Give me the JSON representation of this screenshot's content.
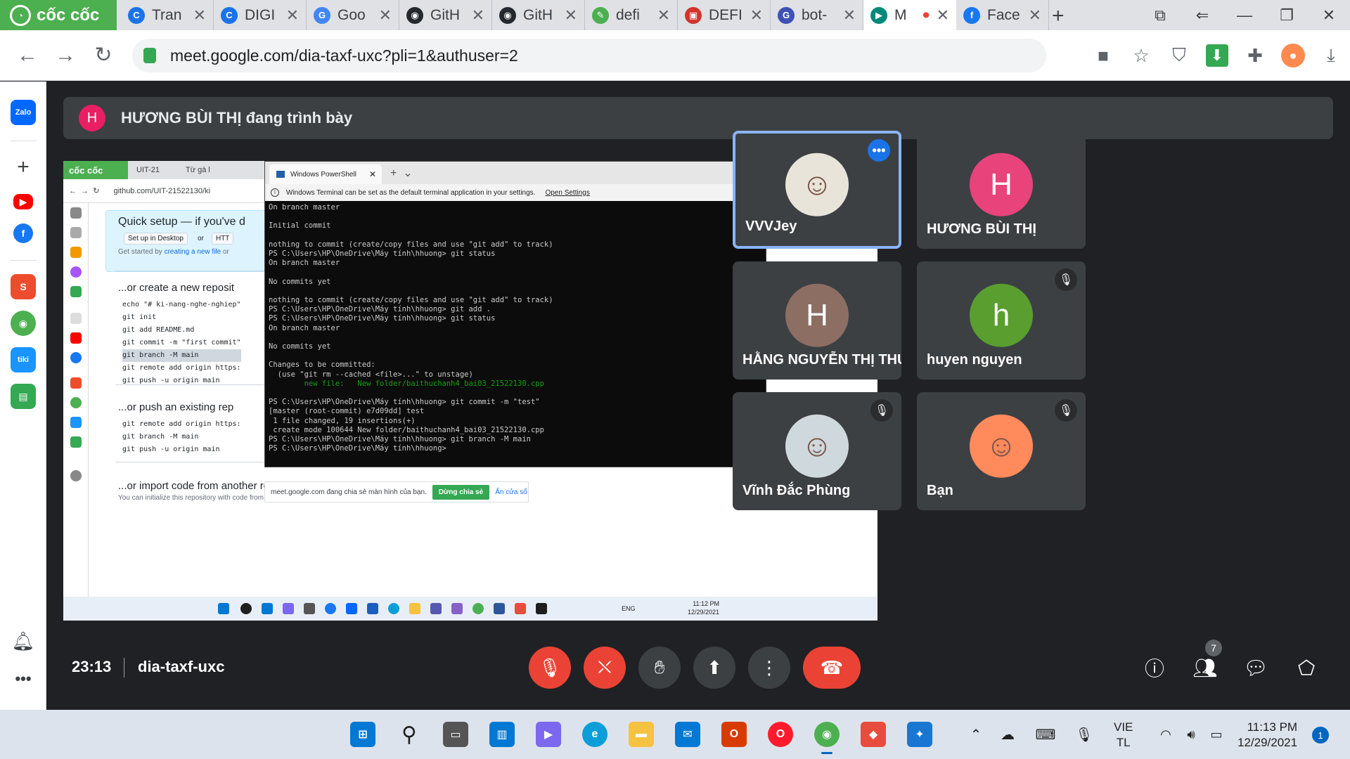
{
  "browser": {
    "brand": "cốc cốc",
    "tabs": [
      {
        "label": "Tran",
        "color": "#1a73e8",
        "glyph": "C"
      },
      {
        "label": "DIGI",
        "color": "#1a73e8",
        "glyph": "C"
      },
      {
        "label": "Goo",
        "color": "#4285f4",
        "glyph": "G"
      },
      {
        "label": "GitH",
        "color": "#24292f",
        "glyph": "◉"
      },
      {
        "label": "GitH",
        "color": "#24292f",
        "glyph": "◉"
      },
      {
        "label": "defi",
        "color": "#4caf50",
        "glyph": "✎"
      },
      {
        "label": "DEFI",
        "color": "#d0342c",
        "glyph": "▣"
      },
      {
        "label": "bot-",
        "color": "#3f51b5",
        "glyph": "G"
      },
      {
        "label": "M",
        "color": "#00897b",
        "glyph": "▶",
        "active": true
      },
      {
        "label": "Face",
        "color": "#1877f2",
        "glyph": "f"
      }
    ],
    "url": "meet.google.com/dia-taxf-uxc?pli=1&authuser=2"
  },
  "meet": {
    "presenter_initial": "H",
    "presenter_text": "HƯƠNG BÙI THỊ đang trình bày",
    "time": "23:13",
    "code": "dia-taxf-uxc",
    "participants_count": "7",
    "tiles": [
      {
        "name": "VVVJey",
        "initial": "",
        "avatar_color": "#e8e4da",
        "active": true,
        "muted": false,
        "more": true
      },
      {
        "name": "HƯƠNG BÙI THỊ",
        "initial": "H",
        "avatar_color": "#e8437a",
        "active": false,
        "muted": false
      },
      {
        "name": "HẰNG NGUYỄN THỊ THÚY",
        "initial": "H",
        "avatar_color": "#8d6e63",
        "active": false,
        "muted": false
      },
      {
        "name": "huyen nguyen",
        "initial": "h",
        "avatar_color": "#5a9e2f",
        "active": false,
        "muted": true
      },
      {
        "name": "Vĩnh Đắc Phùng",
        "initial": "",
        "avatar_color": "#cfd8dc",
        "active": false,
        "muted": true
      },
      {
        "name": "Bạn",
        "initial": "",
        "avatar_color": "#ff8a5c",
        "active": false,
        "muted": true
      }
    ]
  },
  "shared_screen": {
    "brand": "cốc cốc",
    "tab1": "UIT-21",
    "tab2": "Từ gà l",
    "url": "github.com/UIT-21522130/ki",
    "quick_setup": "Quick setup — if you've d",
    "setup_desktop": "Set up in Desktop",
    "or": "or",
    "https": "HTT",
    "get_started": "Get started by ",
    "get_started_link": "creating a new file",
    "get_started_tail": " or",
    "create_heading": "...or create a new reposit",
    "create_code": [
      "echo \"# ki-nang-nghe-nghiep\"",
      "git init",
      "git add README.md",
      "git commit -m \"first commit\"",
      "git branch -M main",
      "git remote add origin https:",
      "git push -u origin main"
    ],
    "push_heading": "...or push an existing rep",
    "push_code": [
      "git remote add origin https:",
      "git branch -M main",
      "git push -u origin main"
    ],
    "import_heading": "...or import code from another re",
    "import_sub": "You can initialize this repository with code from a",
    "ps_title": "Windows PowerShell",
    "ps_info": "Windows Terminal can be set as the default terminal application in your settings.",
    "ps_open_settings": "Open Settings",
    "ps_lines": [
      "On branch master",
      "",
      "Initial commit",
      "",
      "nothing to commit (create/copy files and use \"git add\" to track)",
      "PS C:\\Users\\HP\\OneDrive\\Máy tính\\hhuong> git status",
      "On branch master",
      "",
      "No commits yet",
      "",
      "nothing to commit (create/copy files and use \"git add\" to track)",
      "PS C:\\Users\\HP\\OneDrive\\Máy tính\\hhuong> git add .",
      "PS C:\\Users\\HP\\OneDrive\\Máy tính\\hhuong> git status",
      "On branch master",
      "",
      "No commits yet",
      "",
      "Changes to be committed:",
      "  (use \"git rm --cached <file>...\" to unstage)",
      "        new file:   New folder/baithuchanh4_bai03_21522130.cpp",
      "",
      "PS C:\\Users\\HP\\OneDrive\\Máy tính\\hhuong> git commit -m \"test\"",
      "[master (root-commit) e7d09dd] test",
      " 1 file changed, 19 insertions(+)",
      " create mode 100644 New folder/baithuchanh4_bai03_21522130.cpp",
      "PS C:\\Users\\HP\\OneDrive\\Máy tính\\hhuong> git branch -M main",
      "PS C:\\Users\\HP\\OneDrive\\Máy tính\\hhuong>"
    ],
    "share_notice": "meet.google.com đang chia sẻ màn hình của bạn.",
    "stop_share": "Dừng chia sẻ",
    "hide_window": "Ẩn cửa sổ",
    "eng": "ENG",
    "clock_time": "11:12 PM",
    "clock_date": "12/29/2021"
  },
  "taskbar": {
    "lang1": "VIE",
    "lang2": "TL",
    "time": "11:13 PM",
    "date": "12/29/2021",
    "notif": "1"
  }
}
